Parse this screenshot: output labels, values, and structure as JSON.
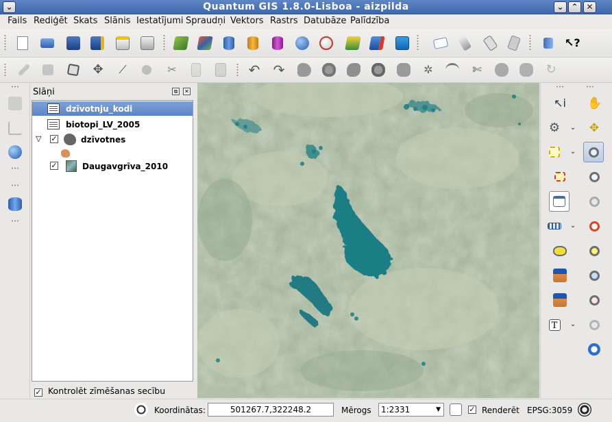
{
  "window": {
    "title": "Quantum GIS 1.8.0-Lisboa - aizpilda",
    "menu_button": "⌄",
    "minimize": "⌄",
    "maximize": "⌃",
    "close": "✕"
  },
  "menu": {
    "items": [
      "Fails",
      "Rediģēt",
      "Skats",
      "Slānis",
      "Iestatījumi",
      "Spraudņi",
      "Vektors",
      "Rastrs",
      "Datubāze",
      "Palīdzība"
    ]
  },
  "layers_panel": {
    "title": "Slāņi",
    "float_button": "⧉",
    "close_button": "✕",
    "layers": [
      {
        "name": "dzīvotnju_kodi",
        "selected": true,
        "checked": null
      },
      {
        "name": "biotopi_LV_2005",
        "selected": false,
        "checked": null
      },
      {
        "name": "dzīvotnes",
        "selected": false,
        "checked": "✓"
      },
      {
        "name": "Daugavgrīva_2010",
        "selected": false,
        "checked": "✓"
      }
    ],
    "expand_arrow": "▽",
    "render_order_label": "Kontrolēt zīmēšanas secību",
    "render_order_checked": "✓"
  },
  "status": {
    "coord_label": "Koordinātas:",
    "coord_value": "501267.7,322248.2",
    "scale_label": "Mērogs",
    "scale_value": "1:2331",
    "scale_dropdown": "▼",
    "render_label": "Renderēt",
    "render_checked": "✓",
    "crs": "EPSG:3059"
  },
  "colors": {
    "selection": "#5d84c6",
    "map_base": "#a9b9a1",
    "water": "#1e7e85"
  }
}
